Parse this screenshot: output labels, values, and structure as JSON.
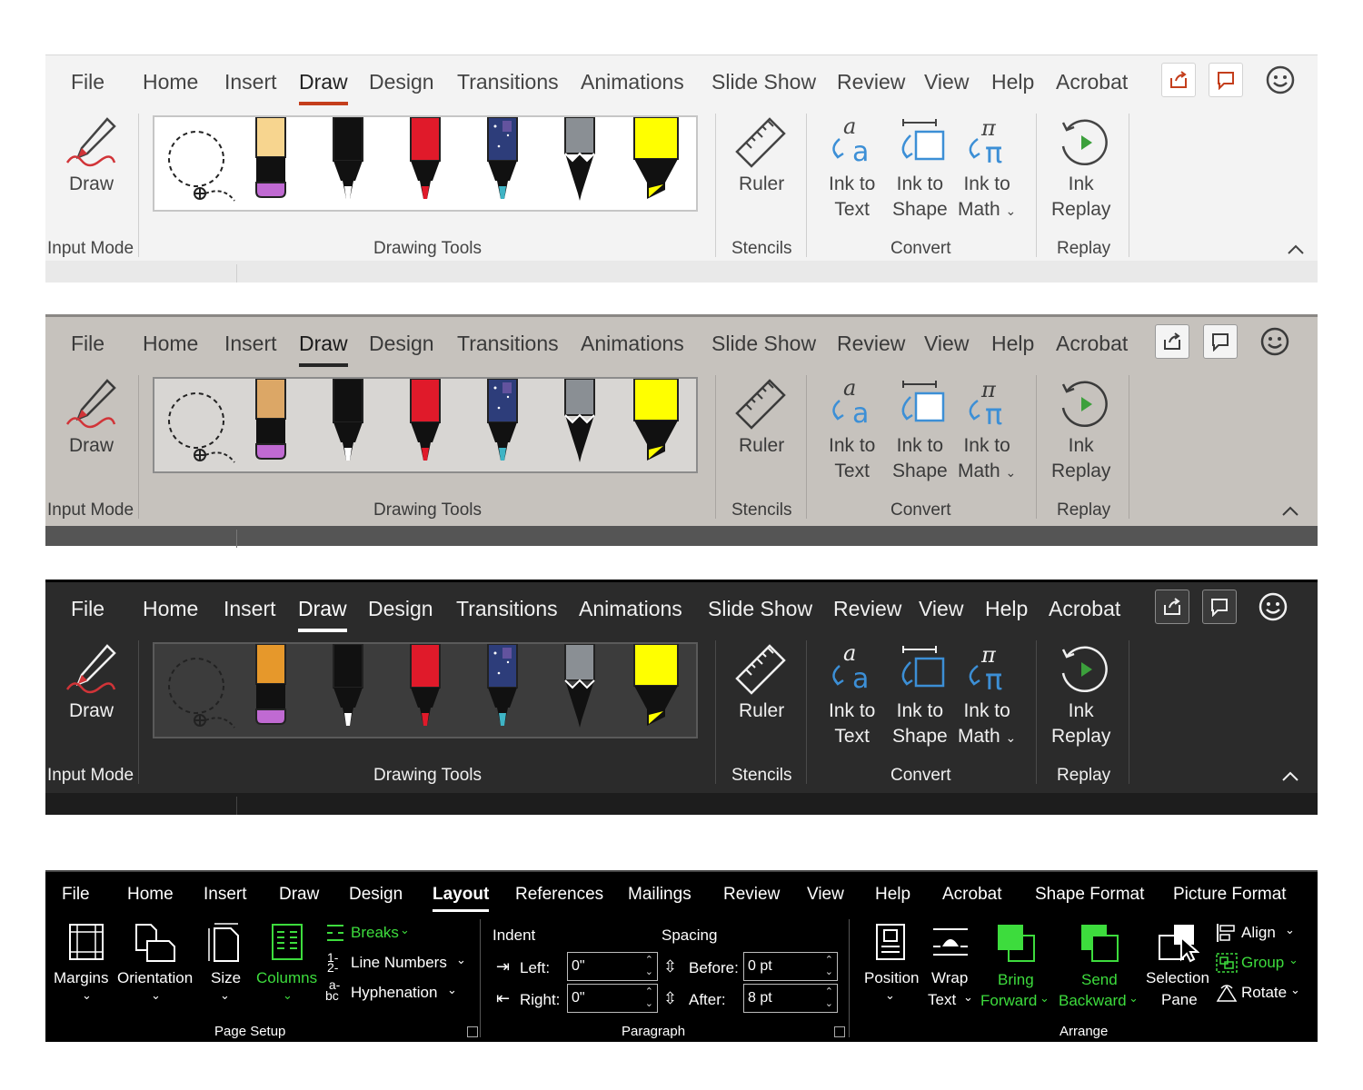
{
  "ppt_tabs": [
    "File",
    "Home",
    "Insert",
    "Draw",
    "Design",
    "Transitions",
    "Animations",
    "Slide Show",
    "Review",
    "View",
    "Help",
    "Acrobat"
  ],
  "ppt_tabs_dark": [
    "File",
    "Home",
    "Insert",
    "Draw",
    "Design",
    "Transitions",
    "Animations",
    "Slide Show",
    "Review",
    "View",
    "Help",
    "Acrobat"
  ],
  "ppt_active_tab": "Draw",
  "ppt": {
    "draw_label": "Draw",
    "ruler_label": "Ruler",
    "ink_to_text_1": "Ink to",
    "ink_to_text_2": "Text",
    "ink_to_shape_1": "Ink to",
    "ink_to_shape_2": "Shape",
    "ink_to_math_1": "Ink to",
    "ink_to_math_2": "Math",
    "ink_replay_1": "Ink",
    "ink_replay_2": "Replay",
    "groups": {
      "input_mode": "Input Mode",
      "drawing_tools": "Drawing Tools",
      "stencils": "Stencils",
      "convert": "Convert",
      "replay": "Replay"
    }
  },
  "themes": {
    "light": {
      "pencil_top": "#f7d58f"
    },
    "gray": {
      "pencil_top": "#dca766"
    },
    "dark": {
      "pencil_top": "#e6982b"
    }
  },
  "word_tabs": [
    "File",
    "Home",
    "Insert",
    "Draw",
    "Design",
    "Layout",
    "References",
    "Mailings",
    "Review",
    "View",
    "Help",
    "Acrobat",
    "Shape Format",
    "Picture Format"
  ],
  "word_active_tab": "Layout",
  "word": {
    "margins": "Margins",
    "orientation": "Orientation",
    "size": "Size",
    "columns": "Columns",
    "breaks": "Breaks",
    "line_numbers": "Line Numbers",
    "hyphenation": "Hyphenation",
    "indent": "Indent",
    "spacing": "Spacing",
    "left": "Left:",
    "right": "Right:",
    "before": "Before:",
    "after": "After:",
    "left_val": "0\"",
    "right_val": "0\"",
    "before_val": "0 pt",
    "after_val": "8 pt",
    "position": "Position",
    "wrap_1": "Wrap",
    "wrap_2": "Text",
    "bring_1": "Bring",
    "bring_2": "Forward",
    "send_1": "Send",
    "send_2": "Backward",
    "selection_1": "Selection",
    "selection_2": "Pane",
    "align": "Align",
    "group": "Group",
    "rotate": "Rotate",
    "page_setup": "Page Setup",
    "paragraph": "Paragraph",
    "arrange": "Arrange"
  }
}
